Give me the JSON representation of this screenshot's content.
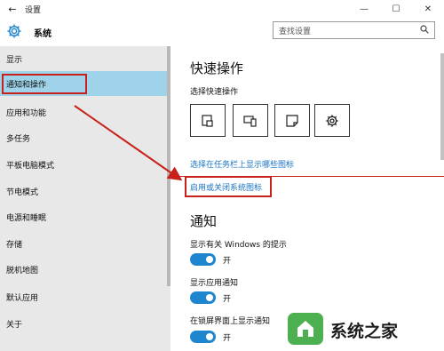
{
  "window": {
    "back_glyph": "←",
    "title": "设置",
    "controls": [
      "—",
      "☐",
      "✕"
    ]
  },
  "header": {
    "app_title": "系统",
    "gear_icon": "gear-icon"
  },
  "search": {
    "placeholder": "查找设置",
    "icon": "search-icon"
  },
  "sidebar": {
    "items": [
      {
        "label": "显示",
        "selected": false
      },
      {
        "label": "通知和操作",
        "selected": true
      },
      {
        "label": "应用和功能",
        "selected": false
      },
      {
        "label": "多任务",
        "selected": false
      },
      {
        "label": "平板电脑模式",
        "selected": false
      },
      {
        "label": "节电模式",
        "selected": false
      },
      {
        "label": "电源和睡眠",
        "selected": false
      },
      {
        "label": "存储",
        "selected": false
      },
      {
        "label": "脱机地图",
        "selected": false
      },
      {
        "label": "默认应用",
        "selected": false
      },
      {
        "label": "关于",
        "selected": false
      }
    ]
  },
  "content": {
    "quick_actions": {
      "heading": "快速操作",
      "subheading": "选择快速操作",
      "tiles": [
        "tablet-mode-icon",
        "connect-icon",
        "note-icon",
        "settings-icon"
      ],
      "link_taskbar": "选择在任务栏上显示哪些图标",
      "link_system_icons": "启用或关闭系统图标"
    },
    "notifications": {
      "heading": "通知",
      "toggles": [
        {
          "label": "显示有关 Windows 的提示",
          "state": "开",
          "on": true
        },
        {
          "label": "显示应用通知",
          "state": "开",
          "on": true
        },
        {
          "label": "在锁屏界面上显示通知",
          "state": "开",
          "on": true
        }
      ]
    }
  },
  "annotation": {
    "highlight_color": "#c8211b"
  },
  "watermark": {
    "text": "系统之家"
  }
}
